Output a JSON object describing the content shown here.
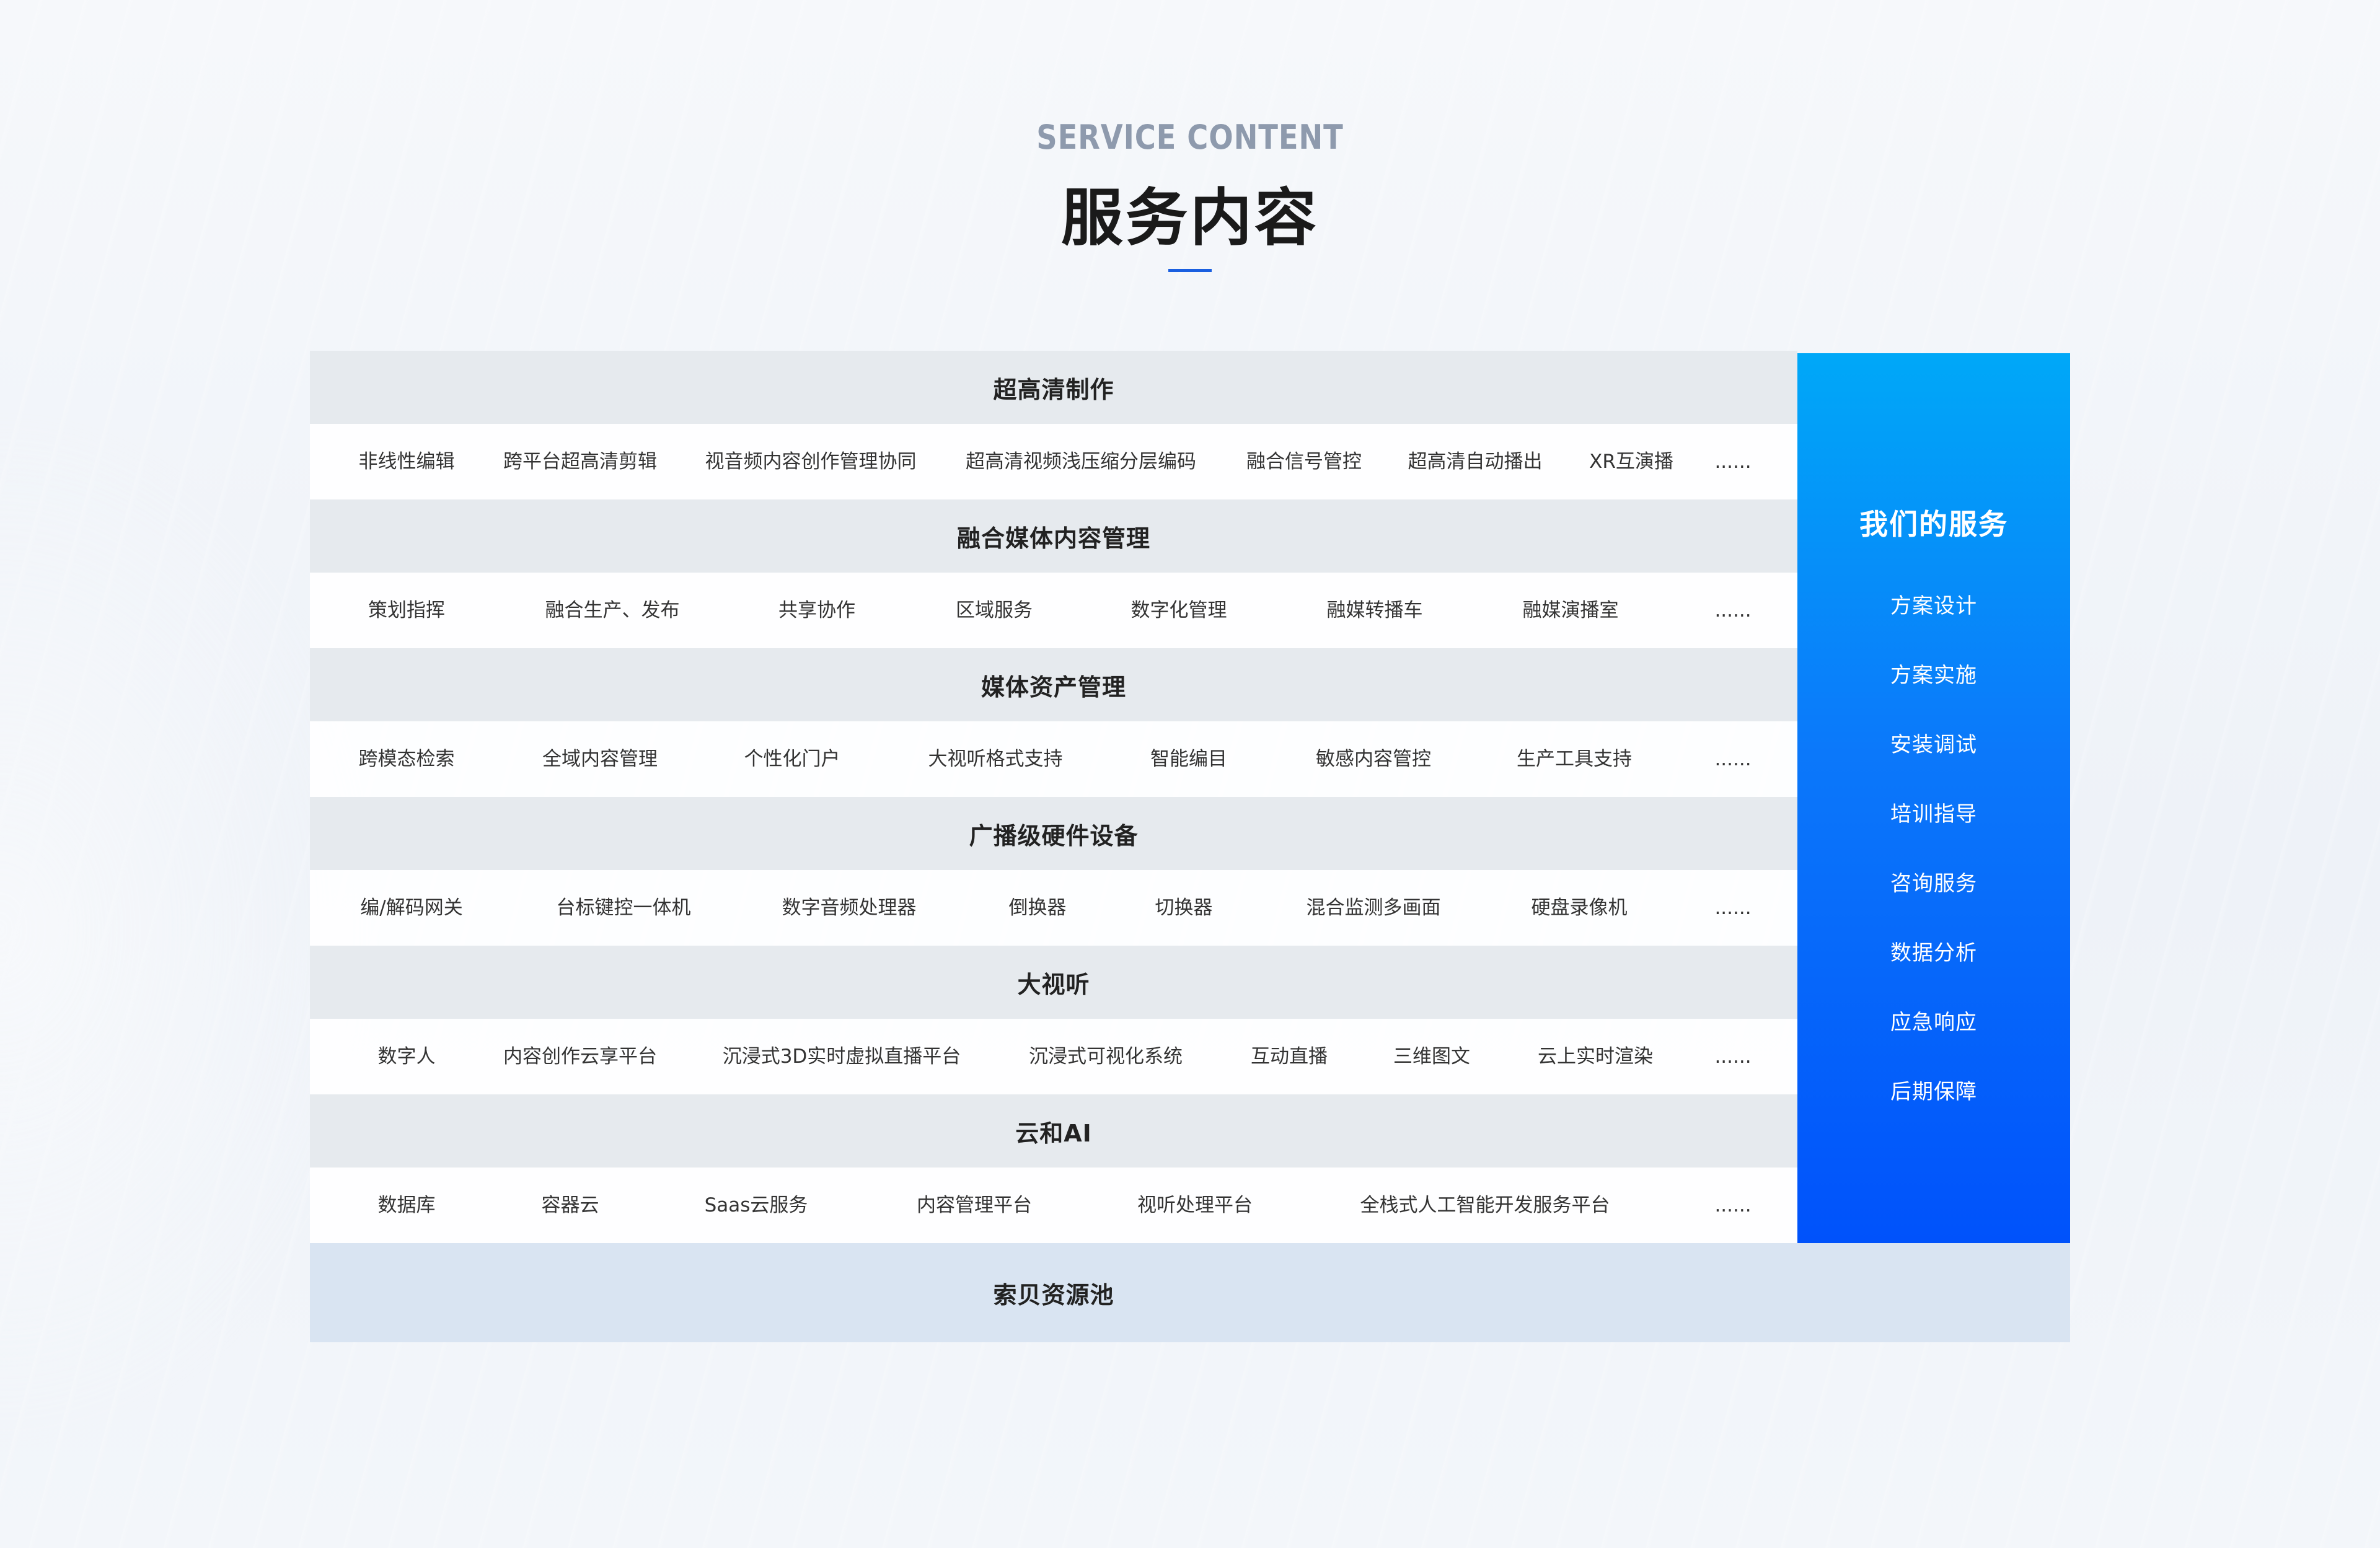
{
  "header": {
    "title_en": "SERVICE CONTENT",
    "title_cn": "服务内容"
  },
  "categories": [
    {
      "title": "超高清制作",
      "items": [
        "非线性编辑",
        "跨平台超高清剪辑",
        "视音频内容创作管理协同",
        "超高清视频浅压缩分层编码",
        "融合信号管控",
        "超高清自动播出",
        "XR互演播",
        "......"
      ]
    },
    {
      "title": "融合媒体内容管理",
      "items": [
        "策划指挥",
        "融合生产、发布",
        "共享协作",
        "区域服务",
        "数字化管理",
        "融媒转播车",
        "融媒演播室",
        "......"
      ]
    },
    {
      "title": "媒体资产管理",
      "items": [
        "跨模态检索",
        "全域内容管理",
        "个性化门户",
        "大视听格式支持",
        "智能编目",
        "敏感内容管控",
        "生产工具支持",
        "......"
      ]
    },
    {
      "title": "广播级硬件设备",
      "items": [
        "编/解码网关",
        "台标键控一体机",
        "数字音频处理器",
        "倒换器",
        "切换器",
        "混合监测多画面",
        "硬盘录像机",
        "......"
      ]
    },
    {
      "title": "大视听",
      "items": [
        "数字人",
        "内容创作云享平台",
        "沉浸式3D实时虚拟直播平台",
        "沉浸式可视化系统",
        "互动直播",
        "三维图文",
        "云上实时渲染",
        "......"
      ]
    },
    {
      "title": "云和AI",
      "items": [
        "数据库",
        "容器云",
        "Saas云服务",
        "内容管理平台",
        "视听处理平台",
        "全栈式人工智能开发服务平台",
        "......"
      ]
    }
  ],
  "resource_pool": {
    "label": "索贝资源池"
  },
  "services": {
    "title": "我们的服务",
    "items": [
      "方案设计",
      "方案实施",
      "安装调试",
      "培训指导",
      "咨询服务",
      "数据分析",
      "应急响应",
      "后期保障"
    ]
  },
  "colors": {
    "accent": "#1a5fe0",
    "side_top": "#00a8f8",
    "side_bottom": "#0052fb"
  }
}
